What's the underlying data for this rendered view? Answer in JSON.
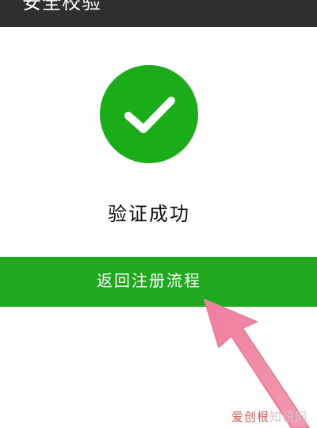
{
  "header": {
    "title": "安全校验"
  },
  "result": {
    "icon": "checkmark-circle-icon",
    "status_text": "验证成功"
  },
  "actions": {
    "return_label": "返回注册流程"
  },
  "annotation": {
    "arrow_color": "#f08aa4"
  },
  "watermark": {
    "brand": "爱创根",
    "suffix": "知识网"
  },
  "colors": {
    "success_green": "#1aad19",
    "button_green": "#20a81e",
    "header_dark": "#2f2f2f"
  }
}
